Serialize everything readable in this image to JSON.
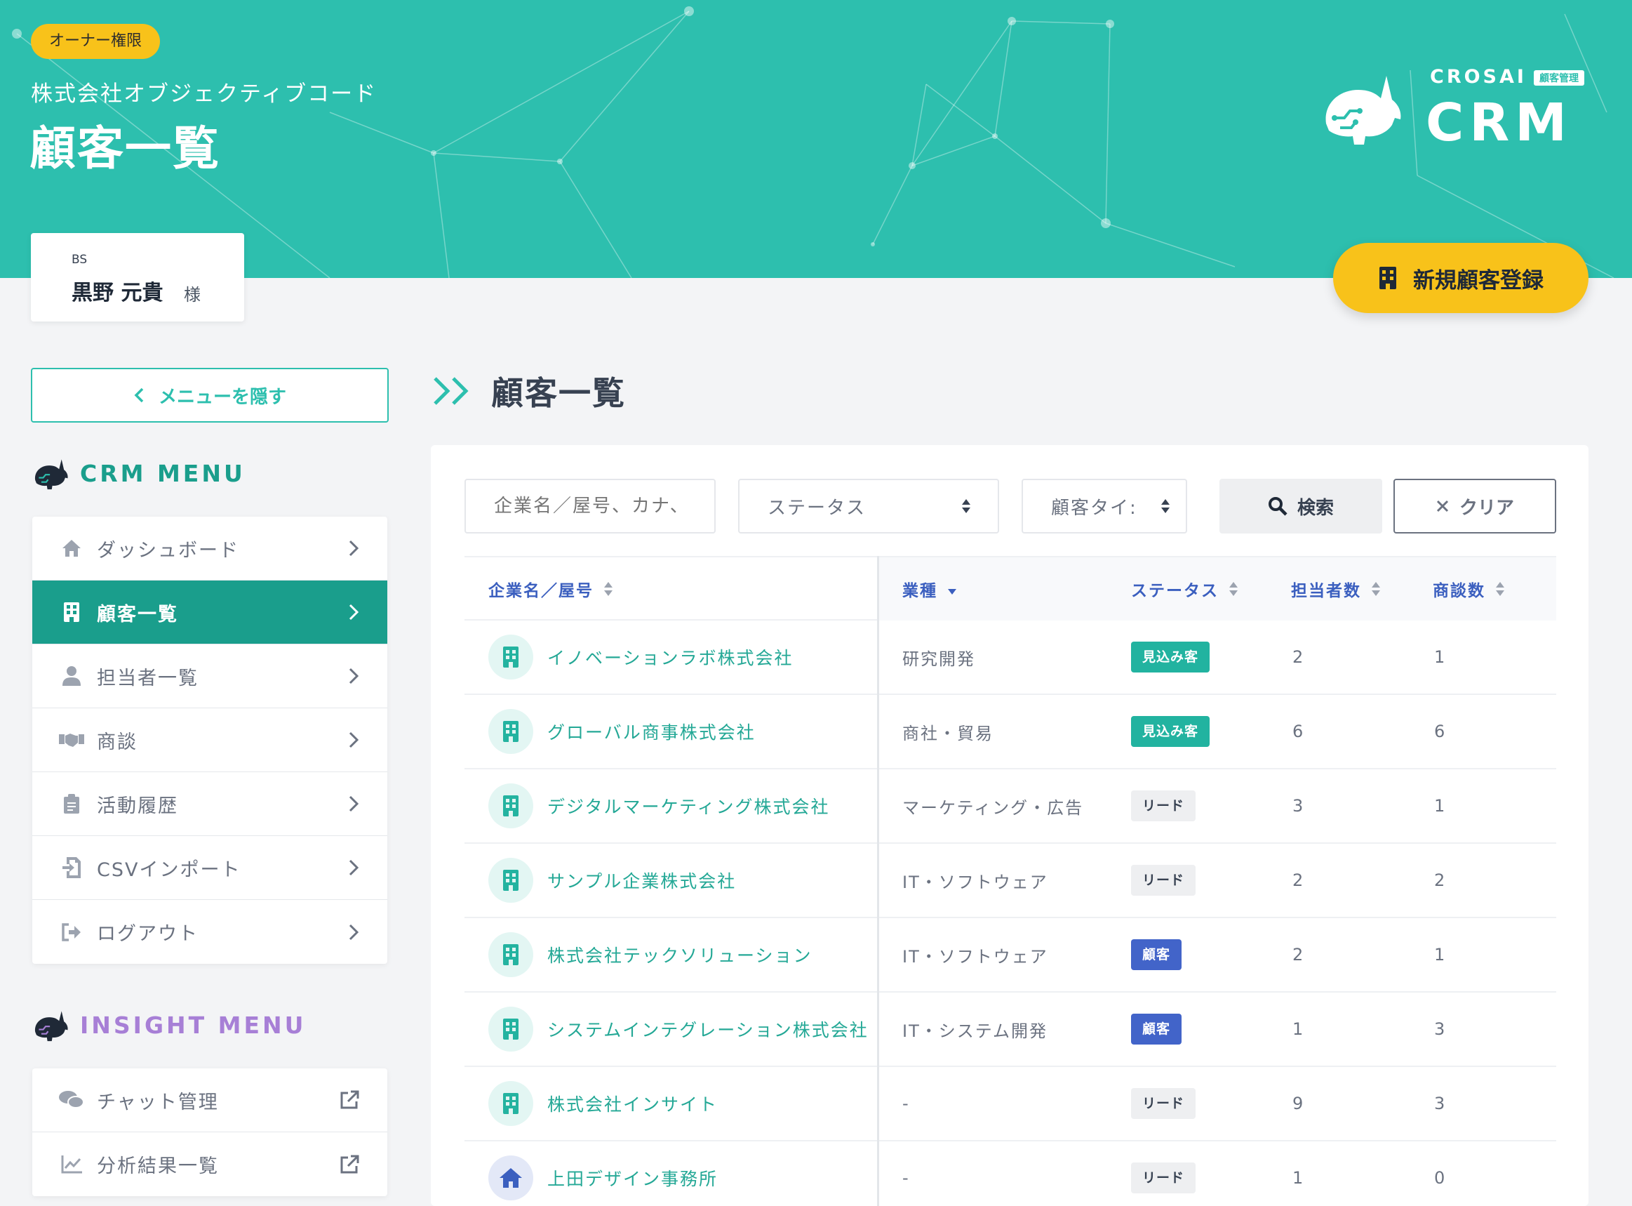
{
  "header": {
    "owner_badge": "オーナー権限",
    "company": "株式会社オブジェクティブコード",
    "title": "顧客一覧",
    "logo_small": "CROSAI",
    "logo_tag": "顧客管理",
    "logo_big": "CRM"
  },
  "user": {
    "dept": "BS",
    "name": "黒野 元貴",
    "honorific": "様"
  },
  "register_button": "新規顧客登録",
  "sidebar": {
    "hide_button": "メニューを隠す",
    "crm_menu_title": "CRM MENU",
    "crm_items": [
      {
        "label": "ダッシュボード",
        "icon": "home-icon"
      },
      {
        "label": "顧客一覧",
        "icon": "building-icon",
        "active": true
      },
      {
        "label": "担当者一覧",
        "icon": "user-icon"
      },
      {
        "label": "商談",
        "icon": "handshake-icon"
      },
      {
        "label": "活動履歴",
        "icon": "clipboard-icon"
      },
      {
        "label": "CSVインポート",
        "icon": "file-import-icon"
      },
      {
        "label": "ログアウト",
        "icon": "logout-icon"
      }
    ],
    "insight_menu_title": "INSIGHT MENU",
    "insight_items": [
      {
        "label": "チャット管理",
        "icon": "chat-icon"
      },
      {
        "label": "分析結果一覧",
        "icon": "chart-line-icon"
      }
    ]
  },
  "main": {
    "title": "顧客一覧",
    "filters": {
      "name_placeholder": "企業名／屋号、カナ、",
      "status": "ステータス",
      "type": "顧客タイ:",
      "search": "検索",
      "clear": "クリア"
    },
    "columns": {
      "name": "企業名／屋号",
      "industry": "業種",
      "status": "ステータス",
      "contacts": "担当者数",
      "deals": "商談数"
    },
    "rows": [
      {
        "name": "イノベーションラボ株式会社",
        "industry": "研究開発",
        "status": "見込み客",
        "status_type": "green",
        "contacts": "2",
        "deals": "1",
        "avatar": "company"
      },
      {
        "name": "グローバル商事株式会社",
        "industry": "商社・貿易",
        "status": "見込み客",
        "status_type": "green",
        "contacts": "6",
        "deals": "6",
        "avatar": "company"
      },
      {
        "name": "デジタルマーケティング株式会社",
        "industry": "マーケティング・広告",
        "status": "リード",
        "status_type": "gray",
        "contacts": "3",
        "deals": "1",
        "avatar": "company"
      },
      {
        "name": "サンプル企業株式会社",
        "industry": "IT・ソフトウェア",
        "status": "リード",
        "status_type": "gray",
        "contacts": "2",
        "deals": "2",
        "avatar": "company"
      },
      {
        "name": "株式会社テックソリューション",
        "industry": "IT・ソフトウェア",
        "status": "顧客",
        "status_type": "blue",
        "contacts": "2",
        "deals": "1",
        "avatar": "company"
      },
      {
        "name": "システムインテグレーション株式会社",
        "industry": "IT・システム開発",
        "status": "顧客",
        "status_type": "blue",
        "contacts": "1",
        "deals": "3",
        "avatar": "company"
      },
      {
        "name": "株式会社インサイト",
        "industry": "-",
        "status": "リード",
        "status_type": "gray",
        "contacts": "9",
        "deals": "3",
        "avatar": "company"
      },
      {
        "name": "上田デザイン事務所",
        "industry": "-",
        "status": "リード",
        "status_type": "gray",
        "contacts": "1",
        "deals": "0",
        "avatar": "individual"
      }
    ]
  },
  "colors": {
    "teal": "#2dbfae",
    "teal_dark": "#1a9e8c",
    "yellow": "#f8c21a",
    "blue": "#4264c9",
    "purple": "#a77fd6"
  }
}
